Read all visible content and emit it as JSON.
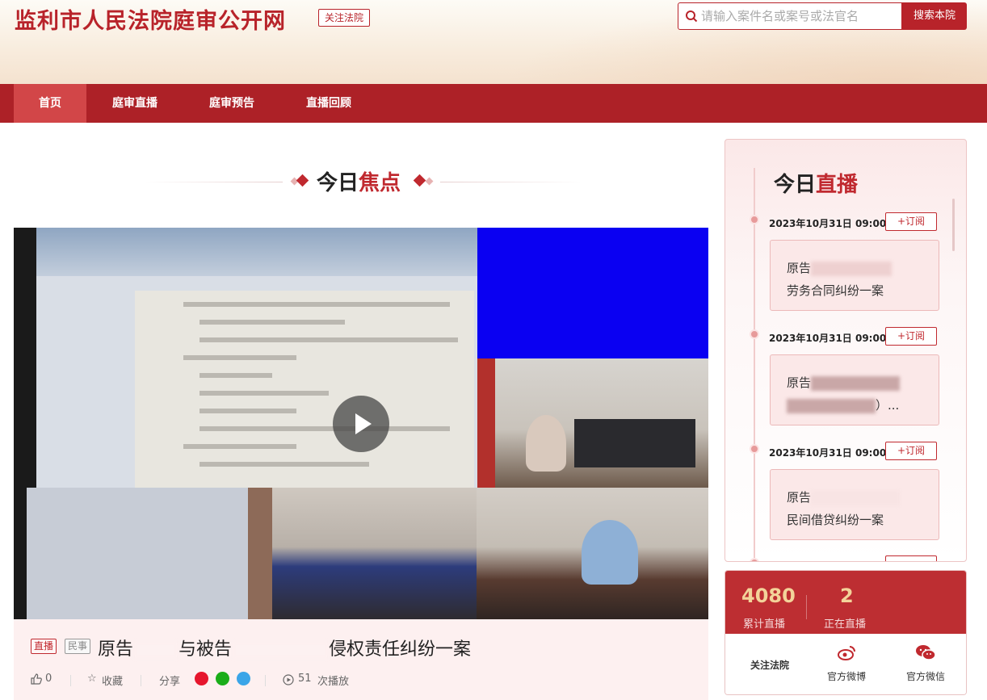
{
  "header": {
    "site_title": "监利市人民法院庭审公开网",
    "follow_tag": "关注法院",
    "search_placeholder": "请输入案件名或案号或法官名",
    "search_button": "搜索本院"
  },
  "nav": {
    "items": [
      {
        "label": "首页",
        "active": true
      },
      {
        "label": "庭审直播",
        "active": false
      },
      {
        "label": "庭审预告",
        "active": false
      },
      {
        "label": "直播回顾",
        "active": false
      }
    ]
  },
  "focus": {
    "title_prefix": "今日",
    "title_highlight": "焦点"
  },
  "video": {
    "play_icon": "play-icon",
    "tags": [
      "直播",
      "民事"
    ],
    "title_part1": "原告",
    "title_part2": "与被告",
    "title_part3": "侵权责任纠纷一案",
    "likes": "0",
    "collect_label": "收藏",
    "share_label": "分享",
    "share_icons": [
      "weibo-icon",
      "wechat-icon",
      "qq-icon"
    ],
    "play_count": "51",
    "play_count_label": "次播放"
  },
  "live_today": {
    "title_prefix": "今日",
    "title_highlight": "直播",
    "items": [
      {
        "time": "2023年10月31日 09:00",
        "subscribe": "+订阅",
        "line1": "原告",
        "line2": "劳务合同纠纷一案"
      },
      {
        "time": "2023年10月31日 09:00",
        "subscribe": "+订阅",
        "line1": "原告",
        "line2": "）..."
      },
      {
        "time": "2023年10月31日 09:00",
        "subscribe": "+订阅",
        "line1": "原告",
        "line2": "民间借贷纠纷一案"
      }
    ]
  },
  "stats": {
    "total_live": "4080",
    "total_live_label": "累计直播",
    "current_live": "2",
    "current_live_label": "正在直播",
    "follow_court": "关注法院",
    "weibo_label": "官方微博",
    "wechat_label": "官方微信"
  },
  "colors": {
    "brand_red": "#ad2127",
    "accent_red": "#c0292f",
    "stat_gold": "#f3d39a"
  }
}
